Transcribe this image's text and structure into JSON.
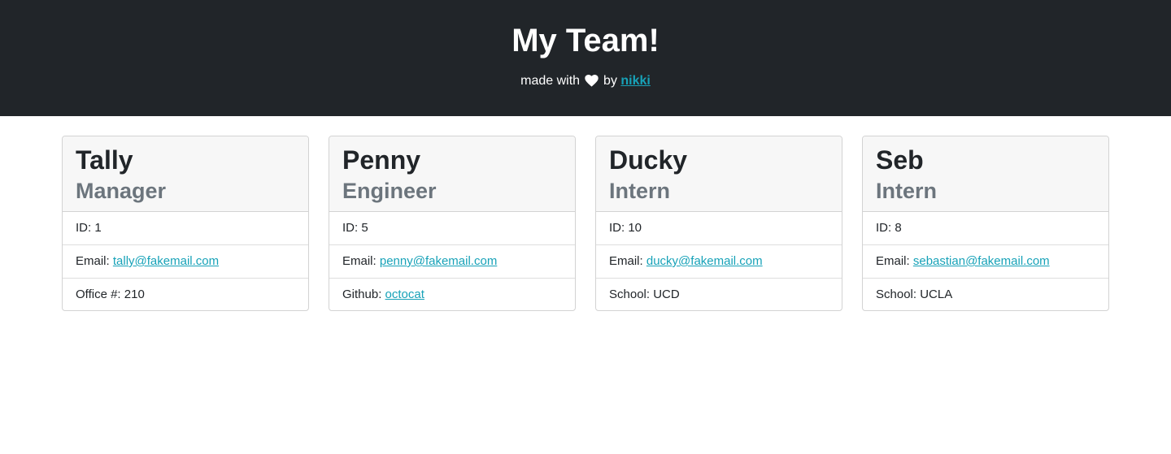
{
  "header": {
    "title": "My Team!",
    "made_with": "made with",
    "by": "by",
    "author": "nikki",
    "heart_icon": "heart-icon",
    "heart_color": "#ffffff",
    "background_color": "#212529",
    "link_color": "#17a2b8"
  },
  "cards": [
    {
      "name": "Tally",
      "role": "Manager",
      "id_label": "ID:",
      "id_value": "1",
      "email_label": "Email:",
      "email_value": "tally@fakemail.com",
      "extra_label": "Office #:",
      "extra_value": "210"
    },
    {
      "name": "Penny",
      "role": "Engineer",
      "id_label": "ID:",
      "id_value": "5",
      "email_label": "Email:",
      "email_value": "penny@fakemail.com",
      "extra_label": "Github:",
      "extra_value": "octocat"
    },
    {
      "name": "Ducky",
      "role": "Intern",
      "id_label": "ID:",
      "id_value": "10",
      "email_label": "Email:",
      "email_value": "ducky@fakemail.com",
      "extra_label": "School:",
      "extra_value": "UCD"
    },
    {
      "name": "Seb",
      "role": "Intern",
      "id_label": "ID:",
      "id_value": "8",
      "email_label": "Email:",
      "email_value": "sebastian@fakemail.com",
      "extra_label": "School:",
      "extra_value": "UCLA"
    }
  ]
}
